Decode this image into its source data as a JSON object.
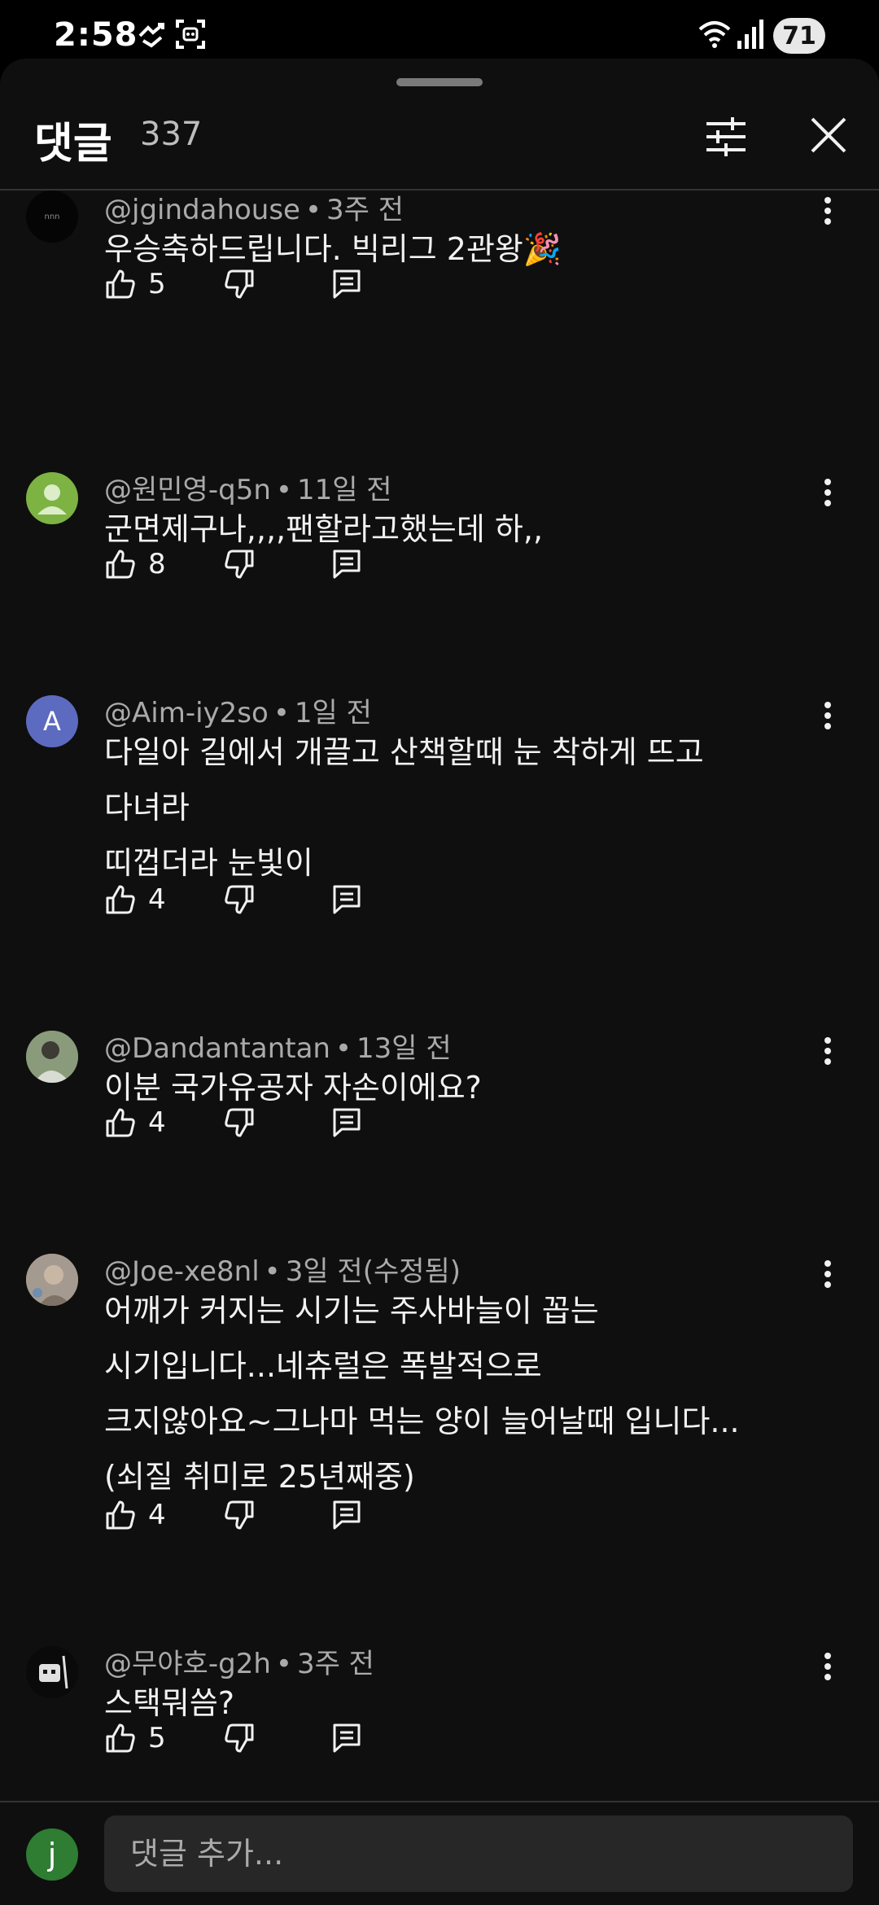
{
  "status_bar": {
    "time": "2:58",
    "battery": "71"
  },
  "header": {
    "title": "댓글",
    "count": "337"
  },
  "comments": [
    {
      "author": "@jgindahouse",
      "time": "3주 전",
      "lines": [
        "우승축하드립니다.  빅리그 2관왕🎉"
      ],
      "likes": "5"
    },
    {
      "author": "@원민영-q5n",
      "time": "11일 전",
      "lines": [
        "군면제구나,,,,팬할라고했는데 하,,"
      ],
      "likes": "8"
    },
    {
      "author": "@Aim-iy2so",
      "time": "1일 전",
      "avatar_letter": "A",
      "lines": [
        "다일아 길에서 개끌고 산책할때 눈 착하게 뜨고",
        "다녀라",
        "띠껍더라 눈빛이"
      ],
      "likes": "4"
    },
    {
      "author": "@Dandantantan",
      "time": "13일 전",
      "lines": [
        "이분 국가유공자 자손이에요?"
      ],
      "likes": "4"
    },
    {
      "author": "@Joe-xe8nl",
      "time": "3일 전(수정됨)",
      "lines": [
        "어깨가 커지는 시기는 주사바늘이 꼽는",
        "시기입니다...네츄럴은 폭발적으로",
        "크지않아요~그나마 먹는 양이 늘어날때 입니다...",
        "(쇠질 취미로 25년째중)"
      ],
      "likes": "4"
    },
    {
      "author": "@무야호-g2h",
      "time": "3주 전",
      "lines": [
        "스택뭐씀?"
      ],
      "likes": "5"
    }
  ],
  "composer": {
    "avatar_letter": "j",
    "placeholder": "댓글 추가..."
  },
  "colors": {
    "background": "#0f0f0f",
    "text": "#f1f1f1",
    "meta": "#aaaaaa",
    "avatar_a": "#5c6bc0",
    "avatar_user": "#2e7d32"
  }
}
